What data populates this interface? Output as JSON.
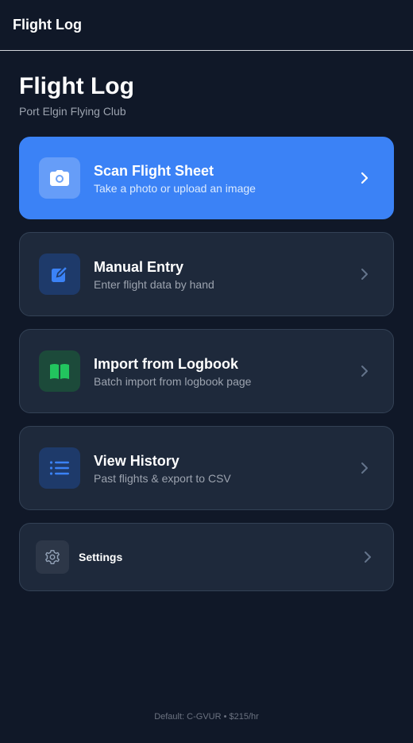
{
  "header": {
    "title": "Flight Log"
  },
  "page": {
    "title": "Flight Log",
    "subtitle": "Port Elgin Flying Club"
  },
  "cards": [
    {
      "title": "Scan Flight Sheet",
      "desc": "Take a photo or upload an image",
      "icon": "camera-icon"
    },
    {
      "title": "Manual Entry",
      "desc": "Enter flight data by hand",
      "icon": "edit-icon"
    },
    {
      "title": "Import from Logbook",
      "desc": "Batch import from logbook page",
      "icon": "book-icon"
    },
    {
      "title": "View History",
      "desc": "Past flights & export to CSV",
      "icon": "list-icon"
    },
    {
      "title": "Settings",
      "icon": "gear-icon"
    }
  ],
  "footer": {
    "text": "Default: C-GVUR • $215/hr"
  },
  "colors": {
    "background": "#101828",
    "primary": "#3b82f6",
    "card": "#1e293b",
    "green": "#22c55e"
  }
}
